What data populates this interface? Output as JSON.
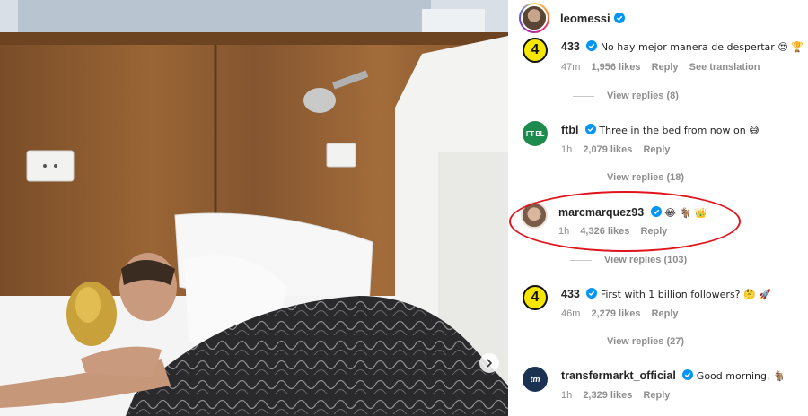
{
  "post": {
    "author": "leomessi"
  },
  "comments": [
    {
      "avatar": "433-logo",
      "avatar_text": "4",
      "user": "433",
      "text": "No hay mejor manera de despertar 😍 🏆",
      "time": "47m",
      "likes": "1,956 likes",
      "reply_label": "Reply",
      "translate_label": "See translation",
      "view_replies": "View replies (8)"
    },
    {
      "avatar": "ftbl-logo",
      "avatar_text": "FT BL",
      "user": "ftbl",
      "text": "Three in the bed from now on 😅",
      "time": "1h",
      "likes": "2,079 likes",
      "reply_label": "Reply",
      "view_replies": "View replies (18)"
    },
    {
      "avatar": "marcmarquez93-photo",
      "user": "marcmarquez93",
      "text": "😂 🐐 👑",
      "time": "1h",
      "likes": "4,326 likes",
      "reply_label": "Reply",
      "view_replies": "View replies (103)"
    },
    {
      "avatar": "433-logo",
      "avatar_text": "4",
      "user": "433",
      "text": "First with 1 billion followers? 🤔 🚀",
      "time": "46m",
      "likes": "2,279 likes",
      "reply_label": "Reply",
      "view_replies": "View replies (27)"
    },
    {
      "avatar": "transfermarkt-logo",
      "avatar_text": "tm",
      "user": "transfermarkt_official",
      "text": "Good morning. 🐐",
      "time": "1h",
      "likes": "2,329 likes",
      "reply_label": "Reply"
    }
  ],
  "icons": {
    "verified": "verified-badge-icon",
    "like": "heart-icon",
    "carousel": "chevron-right-icon"
  },
  "colors": {
    "verified": "#0095f6",
    "highlight": "#e0141c",
    "muted_text": "#8e8e8e"
  }
}
